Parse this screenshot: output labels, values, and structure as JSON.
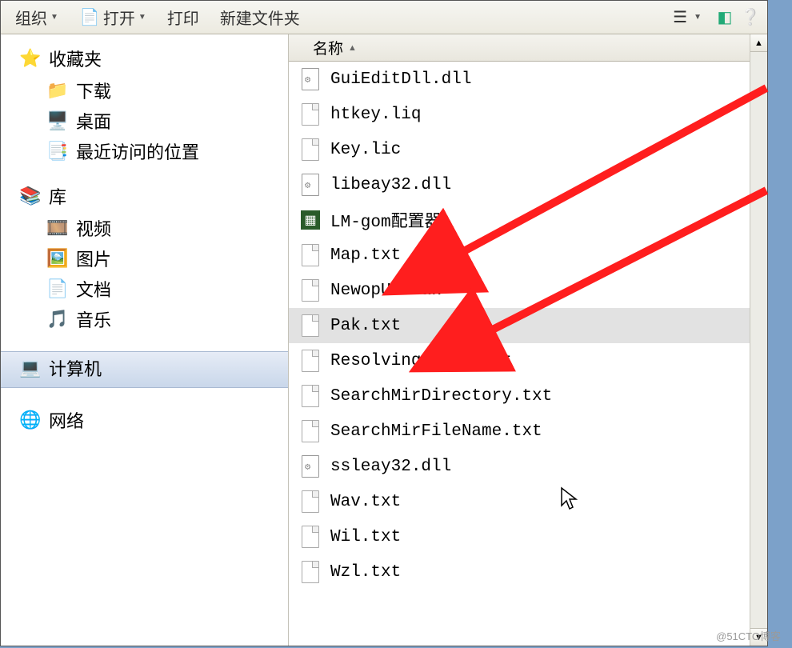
{
  "toolbar": {
    "organize": "组织",
    "open": "打开",
    "print": "打印",
    "new_folder": "新建文件夹"
  },
  "sidebar": {
    "favorites": {
      "label": "收藏夹",
      "items": [
        "下载",
        "桌面",
        "最近访问的位置"
      ]
    },
    "libraries": {
      "label": "库",
      "items": [
        "视频",
        "图片",
        "文档",
        "音乐"
      ]
    },
    "computer": {
      "label": "计算机"
    },
    "network": {
      "label": "网络"
    }
  },
  "header": {
    "name_col": "名称"
  },
  "files": [
    {
      "name": "GuiEditDll.dll",
      "type": "gear",
      "sel": false
    },
    {
      "name": "htkey.liq",
      "type": "page",
      "sel": false
    },
    {
      "name": "Key.lic",
      "type": "page",
      "sel": false
    },
    {
      "name": "libeay32.dll",
      "type": "gear",
      "sel": false
    },
    {
      "name": "LM-gom配置器",
      "type": "exe",
      "sel": false
    },
    {
      "name": "Map.txt",
      "type": "page",
      "sel": false
    },
    {
      "name": "NewopUI.Pak",
      "type": "page",
      "sel": false
    },
    {
      "name": "Pak.txt",
      "type": "page",
      "sel": true
    },
    {
      "name": "ResolvingPower.txt",
      "type": "page",
      "sel": false
    },
    {
      "name": "SearchMirDirectory.txt",
      "type": "page",
      "sel": false
    },
    {
      "name": "SearchMirFileName.txt",
      "type": "page",
      "sel": false
    },
    {
      "name": "ssleay32.dll",
      "type": "gear",
      "sel": false
    },
    {
      "name": "Wav.txt",
      "type": "page",
      "sel": false
    },
    {
      "name": "Wil.txt",
      "type": "page",
      "sel": false
    },
    {
      "name": "Wzl.txt",
      "type": "page",
      "sel": false
    }
  ],
  "watermark": "@51CTO博客"
}
